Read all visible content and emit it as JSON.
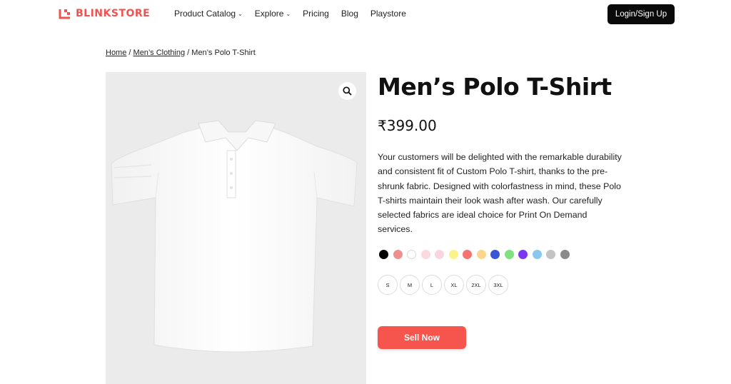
{
  "brand": {
    "name": "BLINKSTORE",
    "color": "#f0524f"
  },
  "nav": {
    "items": [
      {
        "label": "Product Catalog",
        "dropdown": true
      },
      {
        "label": "Explore",
        "dropdown": true
      },
      {
        "label": "Pricing",
        "dropdown": false
      },
      {
        "label": "Blog",
        "dropdown": false
      },
      {
        "label": "Playstore",
        "dropdown": false
      }
    ],
    "login_label": "Login/Sign Up"
  },
  "breadcrumb": {
    "items": [
      {
        "label": "Home",
        "link": true
      },
      {
        "label": "Men’s Clothing",
        "link": true
      },
      {
        "label": "Men’s Polo T-Shirt",
        "link": false
      }
    ],
    "separator": "/"
  },
  "product": {
    "title": "Men’s Polo T-Shirt",
    "price": "₹399.00",
    "description": "Your customers will be delighted with the remarkable durability and consistent fit of Custom Polo T-shirt, thanks to the pre-shrunk fabric. Designed with colorfastness in mind, these Polo T-shirts maintain their look wash after wash. Our carefully selected fabrics are ideal choice for Print On Demand services.",
    "image_icon": "zoom-icon",
    "colors": [
      "#000000",
      "#ef9090",
      "#ffffff",
      "#fbd9de",
      "#fbd3e1",
      "#fbf38a",
      "#f4736e",
      "#fcd58f",
      "#3b55d6",
      "#7ee07e",
      "#7c36f0",
      "#88c8ee",
      "#c4c4c4",
      "#8a8a8a"
    ],
    "sizes": [
      "S",
      "M",
      "L",
      "XL",
      "2XL",
      "3XL"
    ],
    "sell_label": "Sell Now",
    "sell_color": "#f5554d"
  }
}
